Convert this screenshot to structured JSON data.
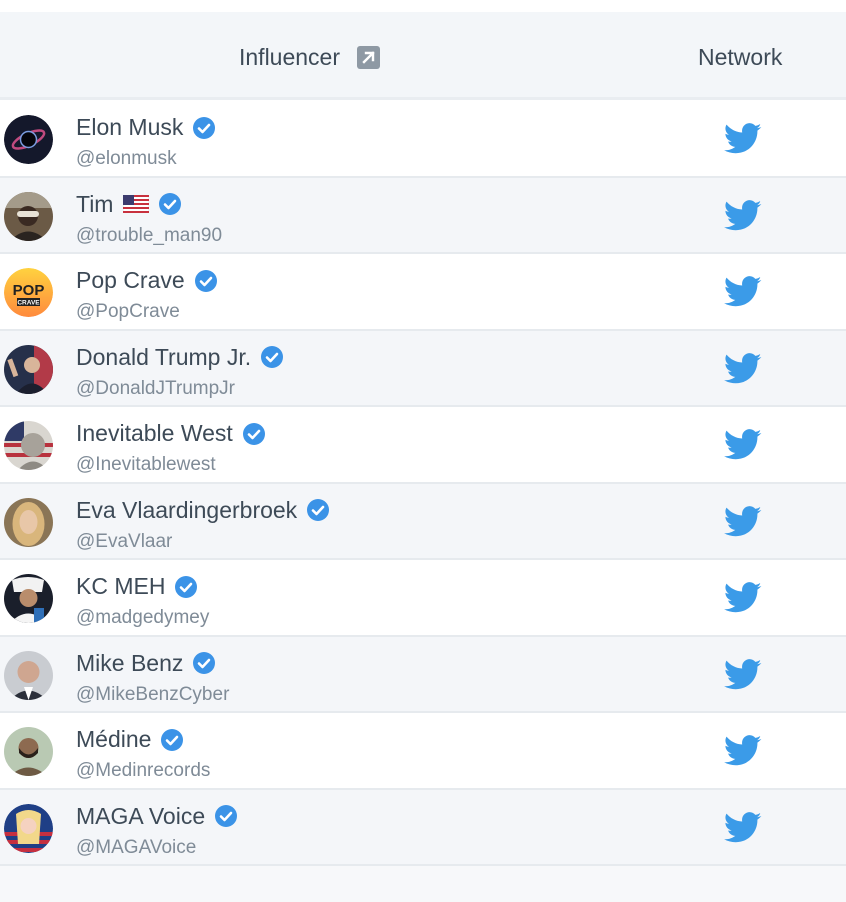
{
  "table": {
    "headers": {
      "influencer": "Influencer",
      "network": "Network"
    },
    "colors": {
      "verified": "#3b93e7",
      "twitter": "#3b9be8",
      "header_bg": "#f3f6f9"
    },
    "rows": [
      {
        "name": "Elon Musk",
        "handle": "@elonmusk",
        "verified": true,
        "network": "twitter-icon"
      },
      {
        "name": "Tim",
        "handle": "@trouble_man90",
        "verified": true,
        "flag": "us-flag-icon",
        "network": "twitter-icon"
      },
      {
        "name": "Pop Crave",
        "handle": "@PopCrave",
        "verified": true,
        "network": "twitter-icon",
        "avatar_text": "POP",
        "avatar_subtext": "CRAVE"
      },
      {
        "name": "Donald Trump Jr.",
        "handle": "@DonaldJTrumpJr",
        "verified": true,
        "network": "twitter-icon"
      },
      {
        "name": "Inevitable West",
        "handle": "@Inevitablewest",
        "verified": true,
        "network": "twitter-icon"
      },
      {
        "name": "Eva Vlaardingerbroek",
        "handle": "@EvaVlaar",
        "verified": true,
        "network": "twitter-icon"
      },
      {
        "name": "KC MEH",
        "handle": "@madgedymey",
        "verified": true,
        "network": "twitter-icon"
      },
      {
        "name": "Mike Benz",
        "handle": "@MikeBenzCyber",
        "verified": true,
        "network": "twitter-icon"
      },
      {
        "name": "Médine",
        "handle": "@Medinrecords",
        "verified": true,
        "network": "twitter-icon"
      },
      {
        "name": "MAGA Voice",
        "handle": "@MAGAVoice",
        "verified": true,
        "network": "twitter-icon"
      }
    ]
  }
}
